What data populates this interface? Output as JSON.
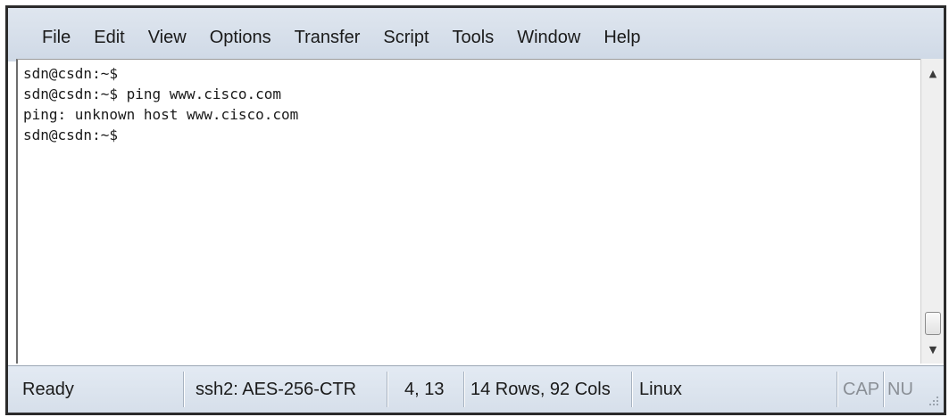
{
  "menubar": {
    "items": [
      "File",
      "Edit",
      "View",
      "Options",
      "Transfer",
      "Script",
      "Tools",
      "Window",
      "Help"
    ]
  },
  "terminal": {
    "lines": [
      "sdn@csdn:~$",
      "sdn@csdn:~$ ping www.cisco.com",
      "ping: unknown host www.cisco.com",
      "sdn@csdn:~$"
    ]
  },
  "scrollbar": {
    "up_icon": "scroll-up-arrow",
    "down_icon": "scroll-down-arrow"
  },
  "statusbar": {
    "status": "Ready",
    "protocol": "ssh2: AES-256-CTR",
    "cursor_pos": "4, 13",
    "dimensions": "14 Rows, 92 Cols",
    "term_type": "Linux",
    "caps": "CAP",
    "num": "NU"
  },
  "colors": {
    "menubar_bg": "#dfe6ef",
    "statusbar_bg": "#e3eaf3",
    "text": "#1a1a1a",
    "frame": "#2b2b2b"
  }
}
